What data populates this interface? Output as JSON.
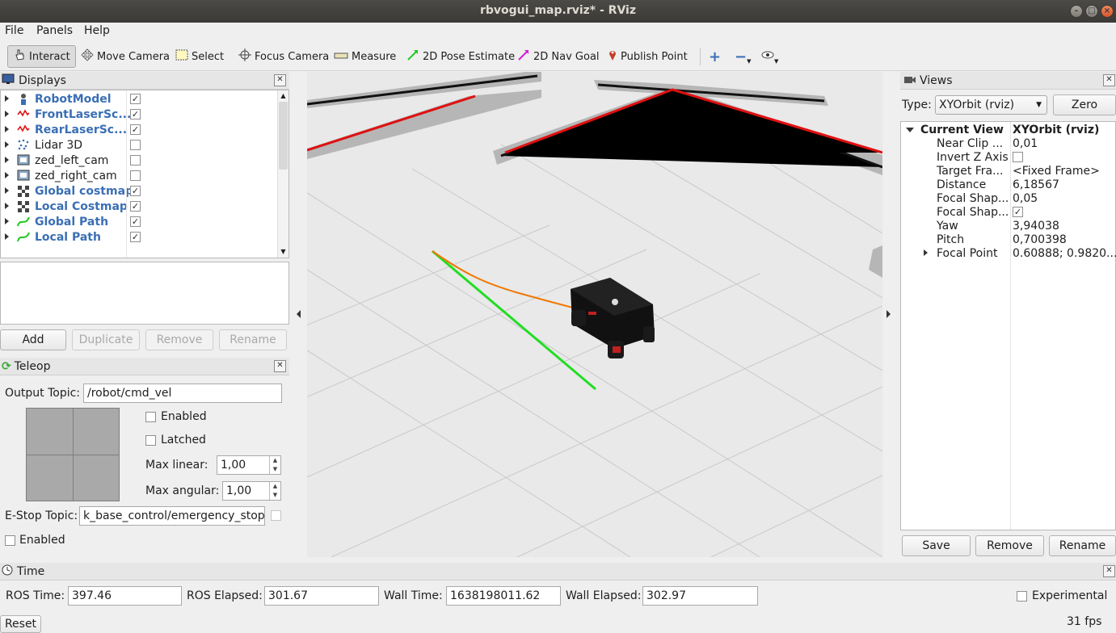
{
  "window": {
    "title": "rbvogui_map.rviz* - RViz"
  },
  "menu": {
    "file": "File",
    "panels": "Panels",
    "help": "Help"
  },
  "toolbar": {
    "interact": "Interact",
    "move_camera": "Move Camera",
    "select": "Select",
    "focus_camera": "Focus Camera",
    "measure": "Measure",
    "pose_estimate": "2D Pose Estimate",
    "nav_goal": "2D Nav Goal",
    "publish_point": "Publish Point"
  },
  "displays": {
    "title": "Displays",
    "items": [
      {
        "label": "RobotModel",
        "checked": true,
        "bold": true
      },
      {
        "label": "FrontLaserSc...",
        "checked": true,
        "bold": true
      },
      {
        "label": "RearLaserSc...",
        "checked": true,
        "bold": true
      },
      {
        "label": "Lidar 3D",
        "checked": false,
        "bold": false
      },
      {
        "label": "zed_left_cam",
        "checked": false,
        "bold": false
      },
      {
        "label": "zed_right_cam",
        "checked": false,
        "bold": false
      },
      {
        "label": "Global costmap",
        "checked": true,
        "bold": true
      },
      {
        "label": "Local Costmap",
        "checked": true,
        "bold": true
      },
      {
        "label": "Global Path",
        "checked": true,
        "bold": true
      },
      {
        "label": "Local Path",
        "checked": true,
        "bold": true
      }
    ],
    "buttons": {
      "add": "Add",
      "duplicate": "Duplicate",
      "remove": "Remove",
      "rename": "Rename"
    }
  },
  "teleop": {
    "title": "Teleop",
    "output_topic_label": "Output Topic:",
    "output_topic_value": "/robot/cmd_vel",
    "enabled_label": "Enabled",
    "latched_label": "Latched",
    "max_linear_label": "Max linear:",
    "max_linear_value": "1,00",
    "max_angular_label": "Max angular:",
    "max_angular_value": "1,00",
    "estop_label": "E-Stop Topic:",
    "estop_value": "k_base_control/emergency_stop",
    "enabled2_label": "Enabled"
  },
  "views": {
    "title": "Views",
    "type_label": "Type:",
    "type_value": "XYOrbit (rviz)",
    "zero": "Zero",
    "current_view": "Current View",
    "current_view_value": "XYOrbit (rviz)",
    "props": [
      {
        "name": "Near Clip ...",
        "value": "0,01"
      },
      {
        "name": "Invert Z Axis",
        "value": ""
      },
      {
        "name": "Target Fra...",
        "value": "<Fixed Frame>"
      },
      {
        "name": "Distance",
        "value": "6,18567"
      },
      {
        "name": "Focal Shap...",
        "value": "0,05"
      },
      {
        "name": "Focal Shap...",
        "value": ""
      },
      {
        "name": "Yaw",
        "value": "3,94038"
      },
      {
        "name": "Pitch",
        "value": "0,700398"
      },
      {
        "name": "Focal Point",
        "value": "0.60888; 0.9820..."
      }
    ],
    "buttons": {
      "save": "Save",
      "remove": "Remove",
      "rename": "Rename"
    }
  },
  "time": {
    "title": "Time",
    "ros_time_label": "ROS Time:",
    "ros_time": "397.46",
    "ros_elapsed_label": "ROS Elapsed:",
    "ros_elapsed": "301.67",
    "wall_time_label": "Wall Time:",
    "wall_time": "1638198011.62",
    "wall_elapsed_label": "Wall Elapsed:",
    "wall_elapsed": "302.97",
    "experimental": "Experimental",
    "reset": "Reset",
    "fps": "31 fps"
  },
  "colors": {
    "accent_blue": "#3a6fb5",
    "global_path": "#22dd22",
    "local_path": "#f07800",
    "laser": "#e01010"
  }
}
